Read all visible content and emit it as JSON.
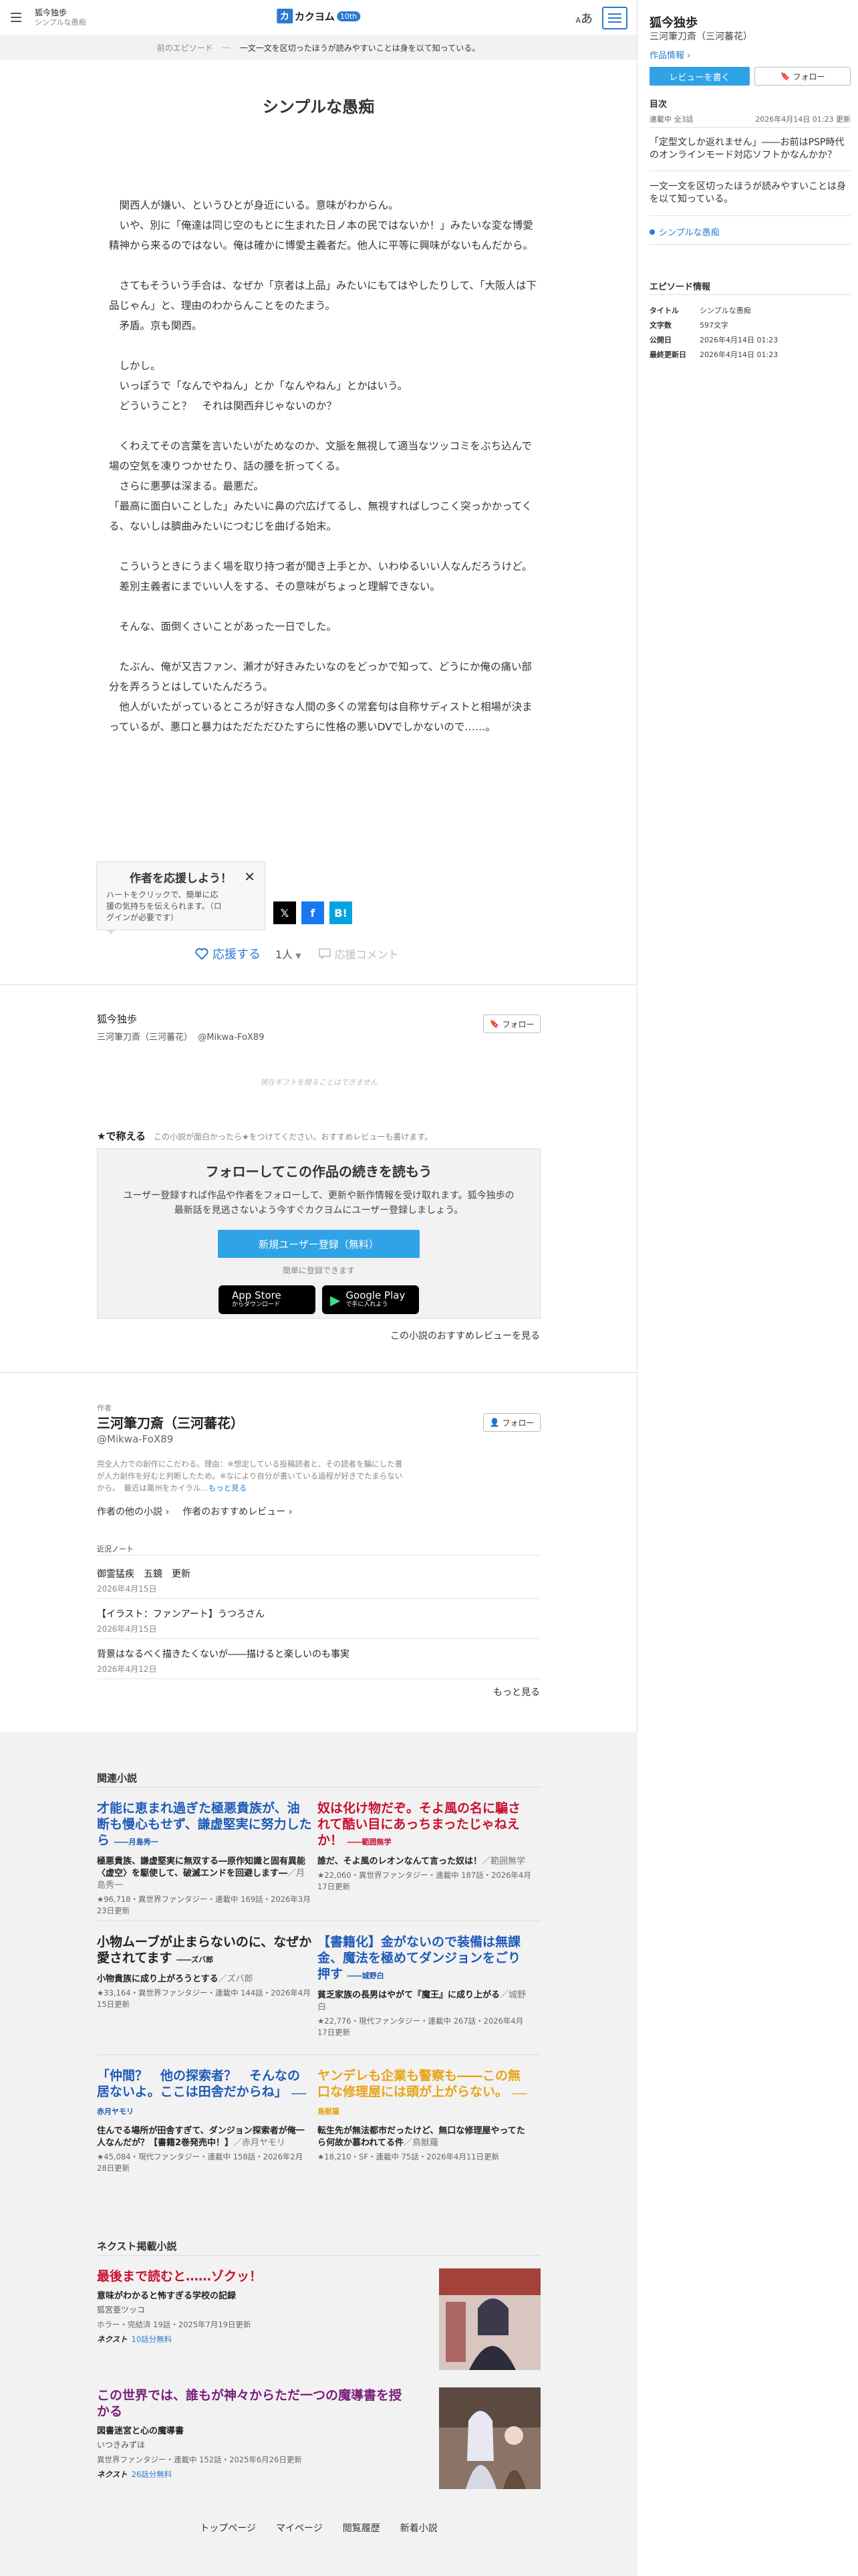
{
  "header": {
    "work_title": "狐今独歩",
    "episode_title": "シンプルな愚痴",
    "logo_mark": "カ",
    "logo_text": "カクヨム",
    "logo_badge": "10th",
    "font_label_big": "あ",
    "font_label_small": "A"
  },
  "epnav": {
    "prev": "前のエピソード",
    "sep": "―",
    "next": "一文一文を区切ったほうが読みやすいことは身を以て知っている。"
  },
  "episode": {
    "title": "シンプルな愚痴",
    "paragraphs": [
      "",
      "　関西人が嫌い、というひとが身近にいる。意味がわからん。",
      "　いや、別に「俺達は同じ空のもとに生まれた日ノ本の民ではないか！」みたいな変な博愛精神から来るのではない。俺は確かに博愛主義者だ。他人に平等に興味がないもんだから。",
      "",
      "　さてもそういう手合は、なぜか「京者は上品」みたいにもてはやしたりして、「大阪人は下品じゃん」と、理由のわからんことをのたまう。",
      "　矛盾。京も関西。",
      "",
      "　しかし。",
      "　いっぽうで「なんでやねん」とか「なんやねん」とかはいう。",
      "　どういうこと？　それは関西弁じゃないのか？",
      "",
      "　くわえてその言葉を言いたいがためなのか、文脈を無視して適当なツッコミをぶち込んで場の空気を凍りつかせたり、話の腰を折ってくる。",
      "　さらに悪夢は深まる。最悪だ。",
      "「最高に面白いことした」みたいに鼻の穴広げてるし、無視すればしつこく突っかかってくる、ないしは臍曲みたいにつむじを曲げる始末。",
      "",
      "　こういうときにうまく場を取り持つ者が聞き上手とか、いわゆるいい人なんだろうけど。",
      "　差別主義者にまでいい人をする、その意味がちょっと理解できない。",
      "",
      "　そんな、面倒くさいことがあった一日でした。",
      "",
      "　たぶん、俺が又吉ファン、瀬才が好きみたいなのをどっかで知って、どうにか俺の痛い部分を弄ろうとはしていたんだろう。",
      "　他人がいたがっているところが好きな人間の多くの常套句は自称サディストと相場が決まっているが、悪口と暴力はただただひたすらに性格の悪いDVでしかないので……。"
    ]
  },
  "support": {
    "popup_title": "作者を応援しよう！",
    "popup_text": "ハートをクリックで、簡単に応援の気持ちを伝えられます。（ログインが必要です）",
    "share_x": "𝕏",
    "share_f": "f",
    "share_b": "B!",
    "cheer_label": "応援する",
    "cheer_count": "1人",
    "comment_label": "応援コメント"
  },
  "work": {
    "title": "狐今独歩",
    "author": "三河筆刀斎（三河蕃花）",
    "author_id": "@Mikwa-FoX89",
    "follow_label": "フォロー",
    "gift_note": "現在ギフトを贈ることはできません"
  },
  "star": {
    "label": "★で称える",
    "hint": "この小説が面白かったら★をつけてください。おすすめレビューも書けます。"
  },
  "follow_box": {
    "title": "フォローしてこの作品の続きを読もう",
    "text": "ユーザー登録すれば作品や作者をフォローして、更新や新作情報を受け取れます。狐今独歩の最新話を見逃さないよう今すぐカクヨムにユーザー登録しましょう。",
    "register": "新規ユーザー登録（無料）",
    "easy": "簡単に登録できます",
    "app_store_small": "からダウンロード",
    "app_store": "App Store",
    "google_play": "Google Play",
    "google_play_small": "で手に入れよう",
    "reviews_link": "この小説のおすすめレビューを見る"
  },
  "author": {
    "caption": "作者",
    "name": "三河筆刀斎（三河蕃花）",
    "id": "@Mikwa-FoX89",
    "follow_label": "フォロー",
    "desc": "完全人力での創作にこだわる。理由：※想定している投稿読者と、その読者を騙にした書が人力創作を好むと判断したため。※なにより自分が書いている過程が好きでたまらないから。　最近は薬州をカイラル…",
    "more": "もっと見る",
    "link_other": "作者の他の小説",
    "link_recommend": "作者のおすすめレビュー",
    "notes_caption": "近況ノート",
    "notes": [
      {
        "title": "御霊猛疾　五鏡　更新",
        "date": "2026年4月15日"
      },
      {
        "title": "【イラスト：ファンアート】うつろさん",
        "date": "2026年4月15日"
      },
      {
        "title": "背景はなるべく描きたくないが――描けると楽しいのも事実",
        "date": "2026年4月12日"
      }
    ],
    "notes_more": "もっと見る"
  },
  "related": {
    "heading": "関連小説",
    "items": [
      {
        "title": "才能に恵まれ過ぎた極悪貴族が、油断も慢心もせず、謙虚堅実に努力したら",
        "author_tag": "――月島秀一",
        "color": "#1e5bb8",
        "desc": "極悪貴族、謙虚堅実に無双する―原作知識と固有異能〈虚空〉を駆使して、破滅エンドを回避します―",
        "desc_author": "／月島秀一",
        "meta": "★96,718・異世界ファンタジー・連載中 169話・2026年3月23日更新"
      },
      {
        "title": "奴は化け物だぞ。そよ風の名に騙されて酷い目にあっちまったじゃねえか！",
        "author_tag": "――範囲無学",
        "color": "#c8102e",
        "desc": "誰だ、そよ風のレオンなんて言った奴は！",
        "desc_author": "／範囲無学",
        "meta": "★22,060・異世界ファンタジー・連載中 187話・2026年4月17日更新"
      },
      {
        "title": "小物ムーブが止まらないのに、なぜか愛されてます",
        "author_tag": "――ズバ郎",
        "color": "#222222",
        "desc": "小物貴族に成り上がろうとする",
        "desc_author": "／ズバ郎",
        "meta": "★33,164・異世界ファンタジー・連載中 144話・2026年4月15日更新"
      },
      {
        "title": "【書籍化】金がないので装備は無課金、魔法を極めてダンジョンをごり押す",
        "author_tag": "――城野白",
        "color": "#1e5bb8",
        "desc": "貧乏家族の長男はやがて『魔王』に成り上がる",
        "desc_author": "／城野白",
        "meta": "★22,776・現代ファンタジー・連載中 267話・2026年4月17日更新"
      },
      {
        "title": "「仲間？　他の探索者？　そんなの居ないよ。ここは田舎だからね」",
        "author_tag": "――赤月ヤモリ",
        "color": "#1e5bb8",
        "desc": "住んでる場所が田舎すぎて、ダンジョン探索者が俺一人なんだが？【書籍2巻発売中！】",
        "desc_author": "／赤月ヤモリ",
        "meta": "★45,084・現代ファンタジー・連載中 158話・2026年2月28日更新"
      },
      {
        "title": "ヤンデレも企業も警察も――この無口な修理屋には頭が上がらない。",
        "author_tag": "――鳥獣羅",
        "color": "#e8a317",
        "desc": "転生先が無法都市だったけど、無口な修理屋やってたら何故か慕われてる件",
        "desc_author": "／鳥獣羅",
        "meta": "★18,210・SF・連載中 75話・2026年4月11日更新"
      }
    ]
  },
  "next": {
    "heading": "ネクスト掲載小説",
    "items": [
      {
        "title": "最後まで読むと……ゾクッ！",
        "color": "#c8102e",
        "desc": "意味がわかると怖すぎる学校の記録",
        "author": "狐宮亜ツッコ",
        "meta": "ホラー・完結済 19話・2025年7月19日更新",
        "brand": "ネクスト",
        "free": "10話分無料"
      },
      {
        "title": "この世界では、誰もが神々からただ一つの魔導書を授かる",
        "color": "#7a1e7a",
        "desc": "図書迷宮と心の魔導書",
        "author": "いつきみずほ",
        "meta": "異世界ファンタジー・連載中 152話・2025年6月26日更新",
        "brand": "ネクスト",
        "free": "26話分無料"
      }
    ]
  },
  "footer": [
    "トップページ",
    "マイページ",
    "閲覧履歴",
    "新着小説"
  ],
  "side": {
    "title": "狐今独歩",
    "author": "三河筆刀斎（三河蕃花）",
    "info": "作品情報",
    "review_btn": "レビューを書く",
    "follow_btn": "フォロー",
    "toc": "目次",
    "status": "連載中 全3話",
    "updated": "2026年4月14日 01:23 更新",
    "episodes": [
      "「定型文しか返れません」――お前はPSP時代のオンラインモード対応ソフトかなんかか？",
      "一文一文を区切ったほうが読みやすいことは身を以て知っている。"
    ],
    "current": "シンプルな愚痴",
    "ep_info_title": "エピソード情報",
    "ep_info": [
      {
        "k": "タイトル",
        "v": "シンプルな愚痴"
      },
      {
        "k": "文字数",
        "v": "597文字"
      },
      {
        "k": "公開日",
        "v": "2026年4月14日 01:23"
      },
      {
        "k": "最終更新日",
        "v": "2026年4月14日 01:23"
      }
    ]
  },
  "colors": {
    "accent": "#2a7bd0",
    "register": "#2fa3e6"
  }
}
